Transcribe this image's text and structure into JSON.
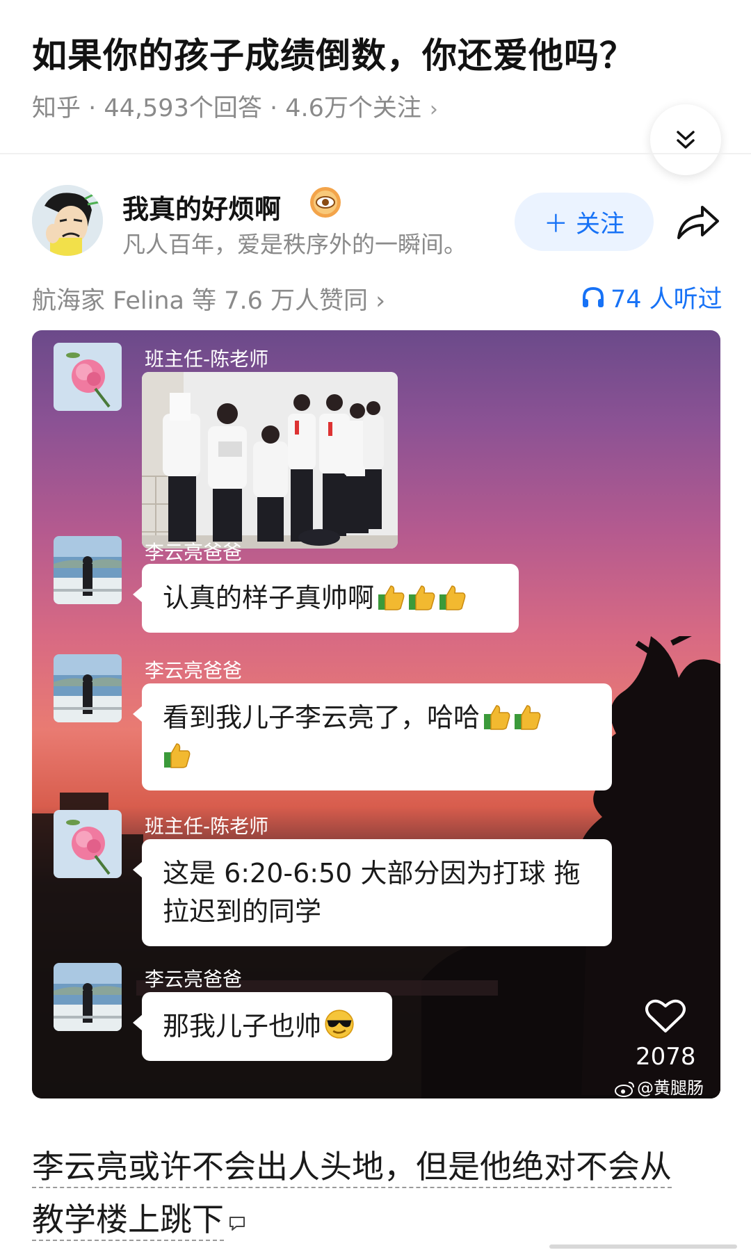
{
  "question": {
    "title": "如果你的孩子成绩倒数，你还爱他吗？",
    "meta": "知乎 · 44,593个回答 · 4.6万个关注",
    "meta_chevron": "›"
  },
  "author": {
    "name": "我真的好烦啊",
    "bio": "凡人百年，爱是秩序外的一瞬间。",
    "follow_label": "＋ 关注"
  },
  "stats": {
    "votes": "航海家 Felina 等 7.6 万人赞同 ›",
    "listened": "74 人听过"
  },
  "chat": {
    "messages": [
      {
        "sender": "班主任-陈老师",
        "type": "image"
      },
      {
        "sender": "李云亮爸爸",
        "text": "认真的样子真帅啊",
        "emoji": "thumbs-up x3"
      },
      {
        "sender": "李云亮爸爸",
        "text_line1": "看到我儿子李云亮了，哈哈",
        "emoji": "thumbs-up x3"
      },
      {
        "sender": "班主任-陈老师",
        "text_line1": "这是 6:20-6:50 大部分因为打球 拖",
        "text_line2": "拉迟到的同学"
      },
      {
        "sender": "李云亮爸爸",
        "text": "那我儿子也帅",
        "emoji": "sunglasses"
      }
    ],
    "like_count": "2078",
    "watermark": "@黄腿肠"
  },
  "caption": {
    "line1": "李云亮或许不会出人头地，但是他绝对不会从",
    "line2": "教学楼上跳下"
  },
  "colors": {
    "accent": "#1772f6",
    "follow_bg": "#ebf3ff",
    "meta": "#8a8a8a"
  },
  "icons": [
    "chevron-double-down-icon",
    "eye-badge-icon",
    "share-icon",
    "headphones-icon",
    "heart-icon",
    "weibo-icon",
    "comment-icon"
  ]
}
